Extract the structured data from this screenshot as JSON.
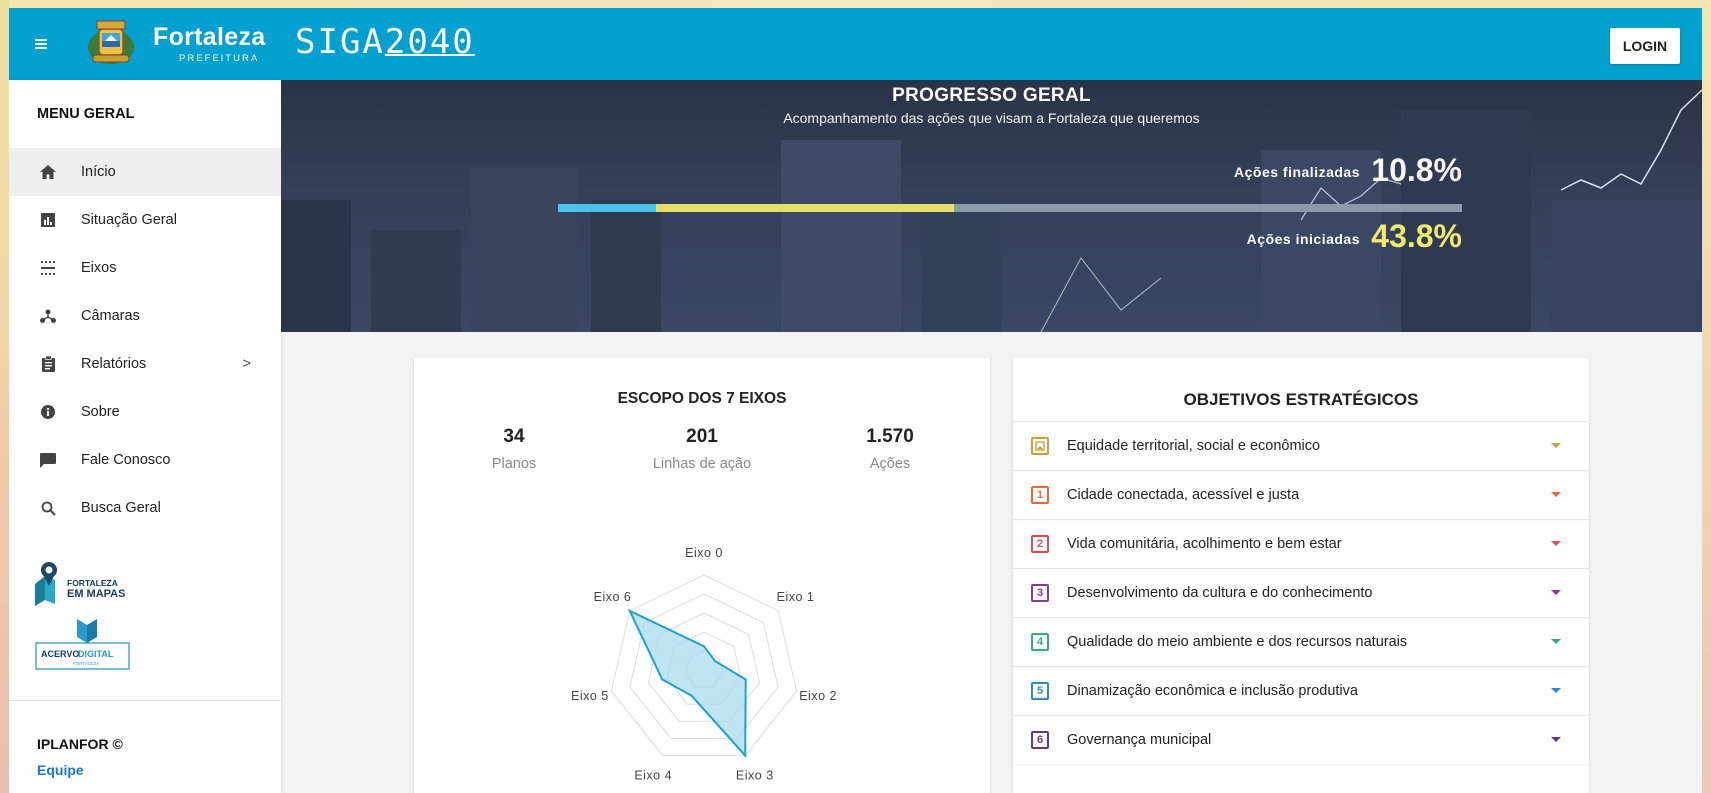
{
  "header": {
    "brand_name": "Fortaleza",
    "brand_sub": "PREFEITURA",
    "siga_logo_pre": "SIGA",
    "siga_logo_post": "2040",
    "login_label": "LOGIN"
  },
  "sidebar": {
    "title": "MENU GERAL",
    "items": [
      {
        "label": "Início",
        "icon": "home-icon"
      },
      {
        "label": "Situação Geral",
        "icon": "bar-chart-icon"
      },
      {
        "label": "Eixos",
        "icon": "axes-icon"
      },
      {
        "label": "Câmaras",
        "icon": "network-icon"
      },
      {
        "label": "Relatórios",
        "icon": "clipboard-icon"
      },
      {
        "label": "Sobre",
        "icon": "info-icon"
      },
      {
        "label": "Fale Conosco",
        "icon": "chat-icon"
      },
      {
        "label": "Busca Geral",
        "icon": "search-icon"
      }
    ],
    "mapas_logo_line1": "FORTALEZA",
    "mapas_logo_line2": "EM MAPAS",
    "acervo_logo_a": "ACERVO",
    "acervo_logo_b": "DIGITAL",
    "acervo_logo_sub": "FORTALEZA",
    "footer_credit": "IPLANFOR ©",
    "footer_team": "Equipe"
  },
  "hero": {
    "title": "PROGRESSO GERAL",
    "subtitle": "Acompanhamento das ações que visam a Fortaleza que queremos",
    "finished_label": "Ações finalizadas",
    "finished_value": "10.8%",
    "started_label": "Ações iniciadas",
    "started_value": "43.8%",
    "finished_fraction": 0.108,
    "started_fraction": 0.438
  },
  "scope": {
    "title": "ESCOPO DOS 7 EIXOS",
    "stats": [
      {
        "value": "34",
        "label": "Planos"
      },
      {
        "value": "201",
        "label": "Linhas de ação"
      },
      {
        "value": "1.570",
        "label": "Ações"
      }
    ],
    "radar": {
      "axes": [
        "Eixo 0",
        "Eixo 1",
        "Eixo 2",
        "Eixo 3",
        "Eixo 4",
        "Eixo 5",
        "Eixo 6"
      ],
      "values": [
        0.25,
        0.15,
        0.45,
        1.0,
        0.3,
        0.45,
        1.0
      ],
      "fill": "#aadcef",
      "stroke": "#1ba3d6"
    }
  },
  "objectives": {
    "title": "OBJETIVOS ESTRATÉGICOS",
    "items": [
      {
        "num": "",
        "label": "Equidade territorial, social e econômico",
        "color": "#c9a13a"
      },
      {
        "num": "1",
        "label": "Cidade conectada, acessível e justa",
        "color": "#e66a3a"
      },
      {
        "num": "2",
        "label": "Vida comunitária, acolhimento e bem estar",
        "color": "#e04d5a"
      },
      {
        "num": "3",
        "label": "Desenvolvimento da cultura e do conhecimento",
        "color": "#8a3a9a"
      },
      {
        "num": "4",
        "label": "Qualidade do meio ambiente e dos recursos naturais",
        "color": "#3aaa7a"
      },
      {
        "num": "5",
        "label": "Dinamização econômica e inclusão produtiva",
        "color": "#2a8acb"
      },
      {
        "num": "6",
        "label": "Governança municipal",
        "color": "#5a3a8a"
      }
    ]
  }
}
